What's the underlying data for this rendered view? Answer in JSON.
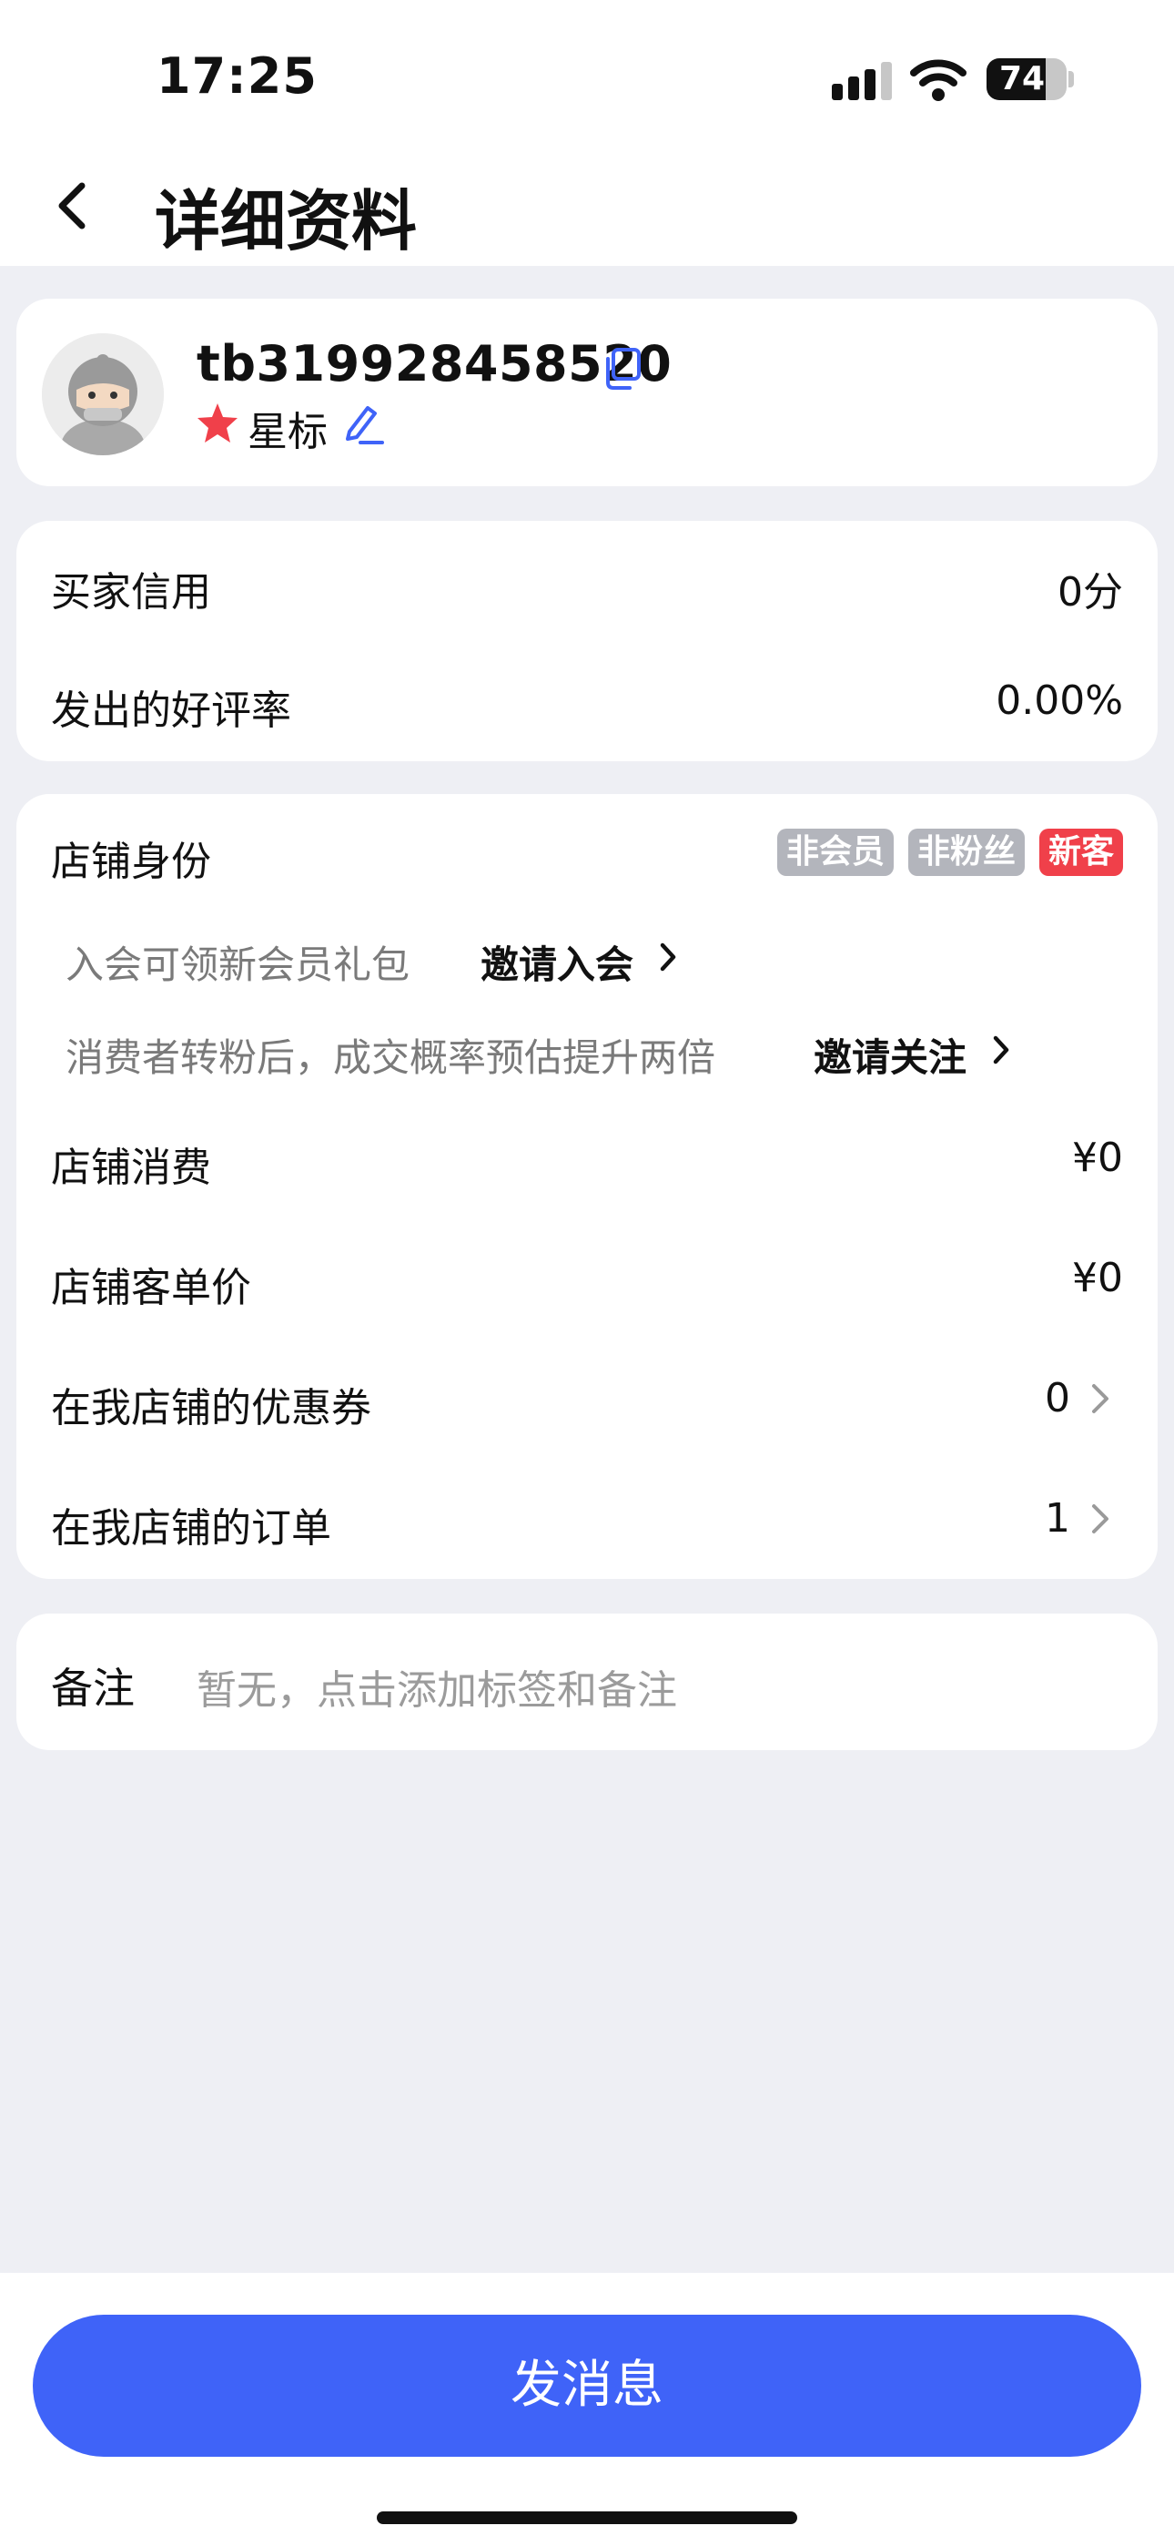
{
  "status_bar": {
    "time": "17:25",
    "battery": "74",
    "battery_level_pct": 74
  },
  "nav": {
    "title": "详细资料"
  },
  "profile": {
    "username": "tb319928458520",
    "star_label": "星标",
    "colors": {
      "star": "#f0404a",
      "icon_blue": "#3f63f8"
    }
  },
  "credit": {
    "rows": [
      {
        "label": "买家信用",
        "value": "0分"
      },
      {
        "label": "发出的好评率",
        "value": "0.00%"
      }
    ]
  },
  "store": {
    "identity_label": "店铺身份",
    "tags": [
      {
        "text": "非会员",
        "color": "#b3b5bc"
      },
      {
        "text": "非粉丝",
        "color": "#b3b5bc"
      },
      {
        "text": "新客",
        "color": "#f0404a"
      }
    ],
    "hints": [
      {
        "text": "入会可领新会员礼包",
        "action": "邀请入会"
      },
      {
        "text": "消费者转粉后，成交概率预估提升两倍",
        "action": "邀请关注"
      }
    ],
    "rows": [
      {
        "label": "店铺消费",
        "value": "¥0"
      },
      {
        "label": "店铺客单价",
        "value": "¥0"
      },
      {
        "label": "在我店铺的优惠券",
        "value": "0"
      },
      {
        "label": "在我店铺的订单",
        "value": "1"
      }
    ]
  },
  "note": {
    "label": "备注",
    "placeholder": "暂无，点击添加标签和备注"
  },
  "send_button": {
    "label": "发消息",
    "color": "#3f63f8"
  }
}
